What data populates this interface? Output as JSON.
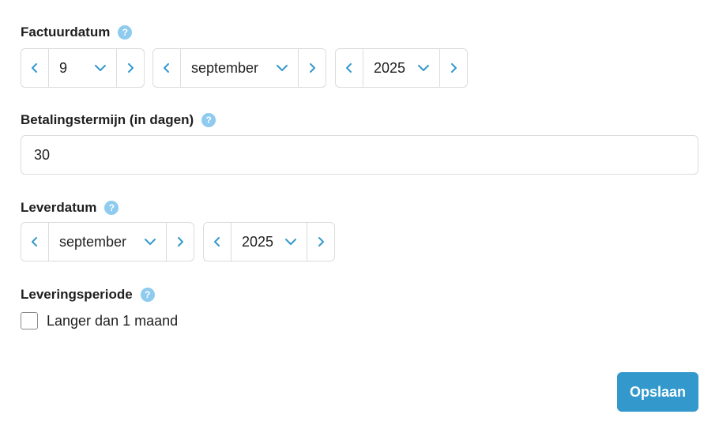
{
  "invoice_date": {
    "label": "Factuurdatum",
    "help": "?",
    "day": "9",
    "month": "september",
    "year": "2025"
  },
  "payment_term": {
    "label": "Betalingstermijn (in dagen)",
    "help": "?",
    "value": "30"
  },
  "delivery_date": {
    "label": "Leverdatum",
    "help": "?",
    "month": "september",
    "year": "2025"
  },
  "delivery_period": {
    "label": "Leveringsperiode",
    "help": "?",
    "checkbox_label": "Langer dan 1 maand",
    "checked": false
  },
  "actions": {
    "save_label": "Opslaan"
  },
  "colors": {
    "accent": "#3399cc",
    "help_icon": "#8ecbee",
    "border": "#dcdcdc"
  }
}
